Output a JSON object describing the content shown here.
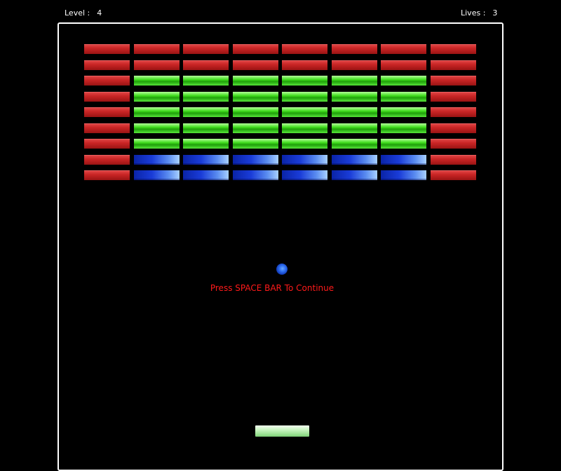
{
  "hud": {
    "level_label": "Level :",
    "level_value": "4",
    "lives_label": "Lives :",
    "lives_value": "3"
  },
  "message": {
    "text": "Press SPACE BAR To Continue"
  },
  "colors": {
    "background": "#000000",
    "border": "#ffffff",
    "message": "#ff1a1a",
    "brick_red": "#c82424",
    "brick_green": "#3fdc1c",
    "brick_blue": "#1a3cd8",
    "ball": "#2f6ff0",
    "paddle": "#c8f4c0"
  },
  "bricks": {
    "columns": 8,
    "rows": [
      [
        "red",
        "red",
        "red",
        "red",
        "red",
        "red",
        "red",
        "red"
      ],
      [
        "red",
        "red",
        "red",
        "red",
        "red",
        "red",
        "red",
        "red"
      ],
      [
        "red",
        "green",
        "green",
        "green",
        "green",
        "green",
        "green",
        "red"
      ],
      [
        "red",
        "green",
        "green",
        "green",
        "green",
        "green",
        "green",
        "red"
      ],
      [
        "red",
        "green",
        "green",
        "green",
        "green",
        "green",
        "green",
        "red"
      ],
      [
        "red",
        "green",
        "green",
        "green",
        "green",
        "green",
        "green",
        "red"
      ],
      [
        "red",
        "green",
        "green",
        "green",
        "green",
        "green",
        "green",
        "red"
      ],
      [
        "red",
        "blue",
        "blue",
        "blue",
        "blue",
        "blue",
        "blue",
        "red"
      ],
      [
        "red",
        "blue",
        "blue",
        "blue",
        "blue",
        "blue",
        "blue",
        "red"
      ]
    ]
  }
}
